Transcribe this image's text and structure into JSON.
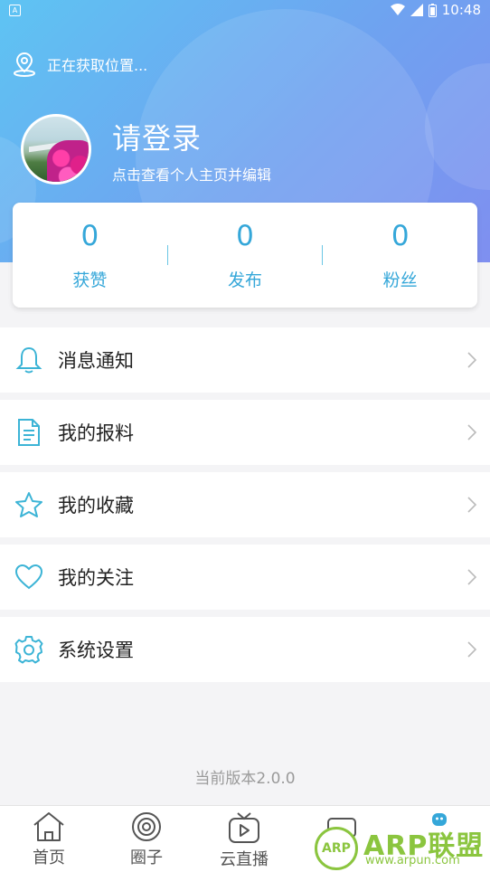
{
  "status_bar": {
    "time": "10:48"
  },
  "location": {
    "text": "正在获取位置..."
  },
  "profile": {
    "title": "请登录",
    "subtitle": "点击查看个人主页并编辑"
  },
  "stats": [
    {
      "value": "0",
      "label": "获赞"
    },
    {
      "value": "0",
      "label": "发布"
    },
    {
      "value": "0",
      "label": "粉丝"
    }
  ],
  "menu": [
    {
      "label": "消息通知",
      "icon": "bell-icon"
    },
    {
      "label": "我的报料",
      "icon": "document-icon"
    },
    {
      "label": "我的收藏",
      "icon": "star-icon"
    },
    {
      "label": "我的关注",
      "icon": "heart-icon"
    },
    {
      "label": "系统设置",
      "icon": "gear-icon"
    }
  ],
  "version": "当前版本2.0.0",
  "tabs": [
    {
      "label": "首页",
      "icon": "home-icon"
    },
    {
      "label": "圈子",
      "icon": "circle-icon"
    },
    {
      "label": "云直播",
      "icon": "tv-play-icon"
    }
  ],
  "watermark": {
    "logo": "ARP",
    "text": "ARP联盟",
    "url": "www.arpun.com"
  },
  "colors": {
    "accent": "#35a7d9",
    "header_start": "#5ec4f3",
    "header_end": "#7f8ff0",
    "watermark": "#8bc53f"
  }
}
